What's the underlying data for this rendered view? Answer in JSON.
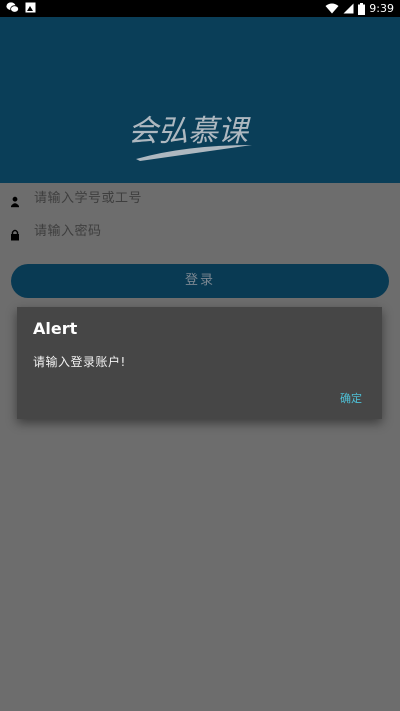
{
  "status_bar": {
    "time": "9:39",
    "left_icons": [
      "wechat-icon",
      "image-icon"
    ],
    "right_icons": [
      "wifi-icon",
      "signal-icon",
      "battery-icon"
    ]
  },
  "header": {
    "background": "#0a3e58",
    "logo_text": "会弘慕课"
  },
  "form": {
    "username_placeholder": "请输入学号或工号",
    "password_placeholder": "请输入密码",
    "login_label": "登录"
  },
  "dialog": {
    "title": "Alert",
    "message": "请输入登录账户!",
    "ok_label": "确定",
    "ok_color": "#4ec0d6"
  }
}
